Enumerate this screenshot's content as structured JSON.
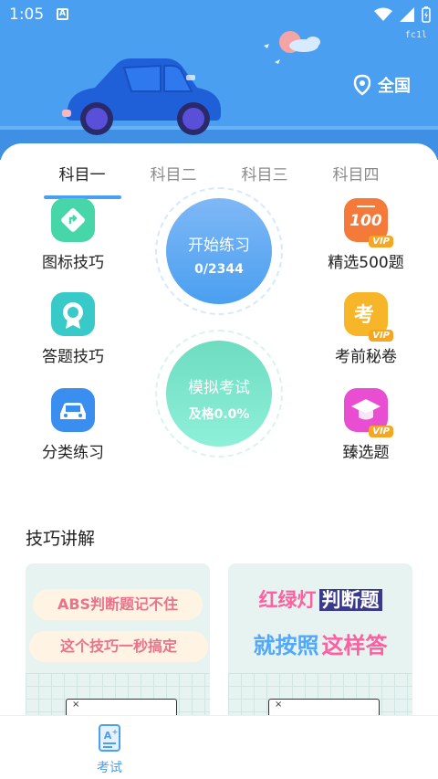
{
  "status_bar": {
    "time": "1:05",
    "debug_label": "fc1l"
  },
  "header": {
    "location_label": "全国"
  },
  "tabs": [
    {
      "label": "科目一",
      "active": true
    },
    {
      "label": "科目二",
      "active": false
    },
    {
      "label": "科目三",
      "active": false
    },
    {
      "label": "科目四",
      "active": false
    }
  ],
  "features": {
    "sign_tips": {
      "label": "图标技巧",
      "icon": "turn-sign-icon"
    },
    "answer_tips": {
      "label": "答题技巧",
      "icon": "rosette-icon"
    },
    "category_practice": {
      "label": "分类练习",
      "icon": "car-icon"
    },
    "selected_500": {
      "label": "精选500题",
      "icon": "score-100-icon",
      "badge": "VIP"
    },
    "pre_exam_secret": {
      "label": "考前秘卷",
      "icon": "exam-icon",
      "badge": "VIP"
    },
    "curated": {
      "label": "臻选题",
      "icon": "graduation-cap-icon",
      "badge": "VIP"
    }
  },
  "practice": {
    "title": "开始练习",
    "progress": "0/2344"
  },
  "mock_exam": {
    "title": "模拟考试",
    "pass_rate": "及格0.0%"
  },
  "tips_section": {
    "title": "技巧讲解",
    "cards": [
      {
        "line1": "ABS判断题记不住",
        "line2": "这个技巧一秒搞定"
      },
      {
        "line1a": "红绿灯",
        "line1b": "判断题",
        "line2a": "就按照",
        "line2b": "这样答"
      }
    ]
  },
  "bottom_nav": {
    "exam_label": "考试"
  },
  "colors": {
    "primary": "#4a9ff0",
    "vip": "#f5a623"
  }
}
